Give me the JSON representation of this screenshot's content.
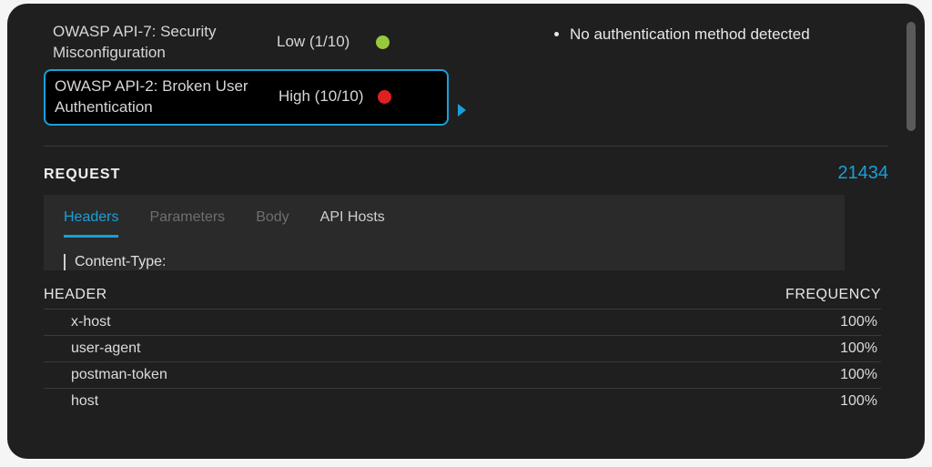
{
  "colors": {
    "accent": "#1a9fd8",
    "low": "#98c93c",
    "high": "#e02020"
  },
  "risks": [
    {
      "title": "OWASP API-7: Security Misconfiguration",
      "severity_label": "Low (1/10)",
      "level": "low",
      "selected": false
    },
    {
      "title": "OWASP API-2: Broken User Authentication",
      "severity_label": "High (10/10)",
      "level": "high",
      "selected": true
    }
  ],
  "details": {
    "items": [
      "No authentication method detected"
    ]
  },
  "request": {
    "label": "REQUEST",
    "count": "21434",
    "tabs": [
      {
        "label": "Headers",
        "state": "active"
      },
      {
        "label": "Parameters",
        "state": "disabled"
      },
      {
        "label": "Body",
        "state": "disabled"
      },
      {
        "label": "API Hosts",
        "state": "enabled"
      }
    ],
    "content_type_label": "Content-Type:",
    "table": {
      "header_col": "HEADER",
      "freq_col": "FREQUENCY",
      "rows": [
        {
          "header": "x-host",
          "freq": "100%"
        },
        {
          "header": "user-agent",
          "freq": "100%"
        },
        {
          "header": "postman-token",
          "freq": "100%"
        },
        {
          "header": "host",
          "freq": "100%"
        }
      ]
    }
  }
}
